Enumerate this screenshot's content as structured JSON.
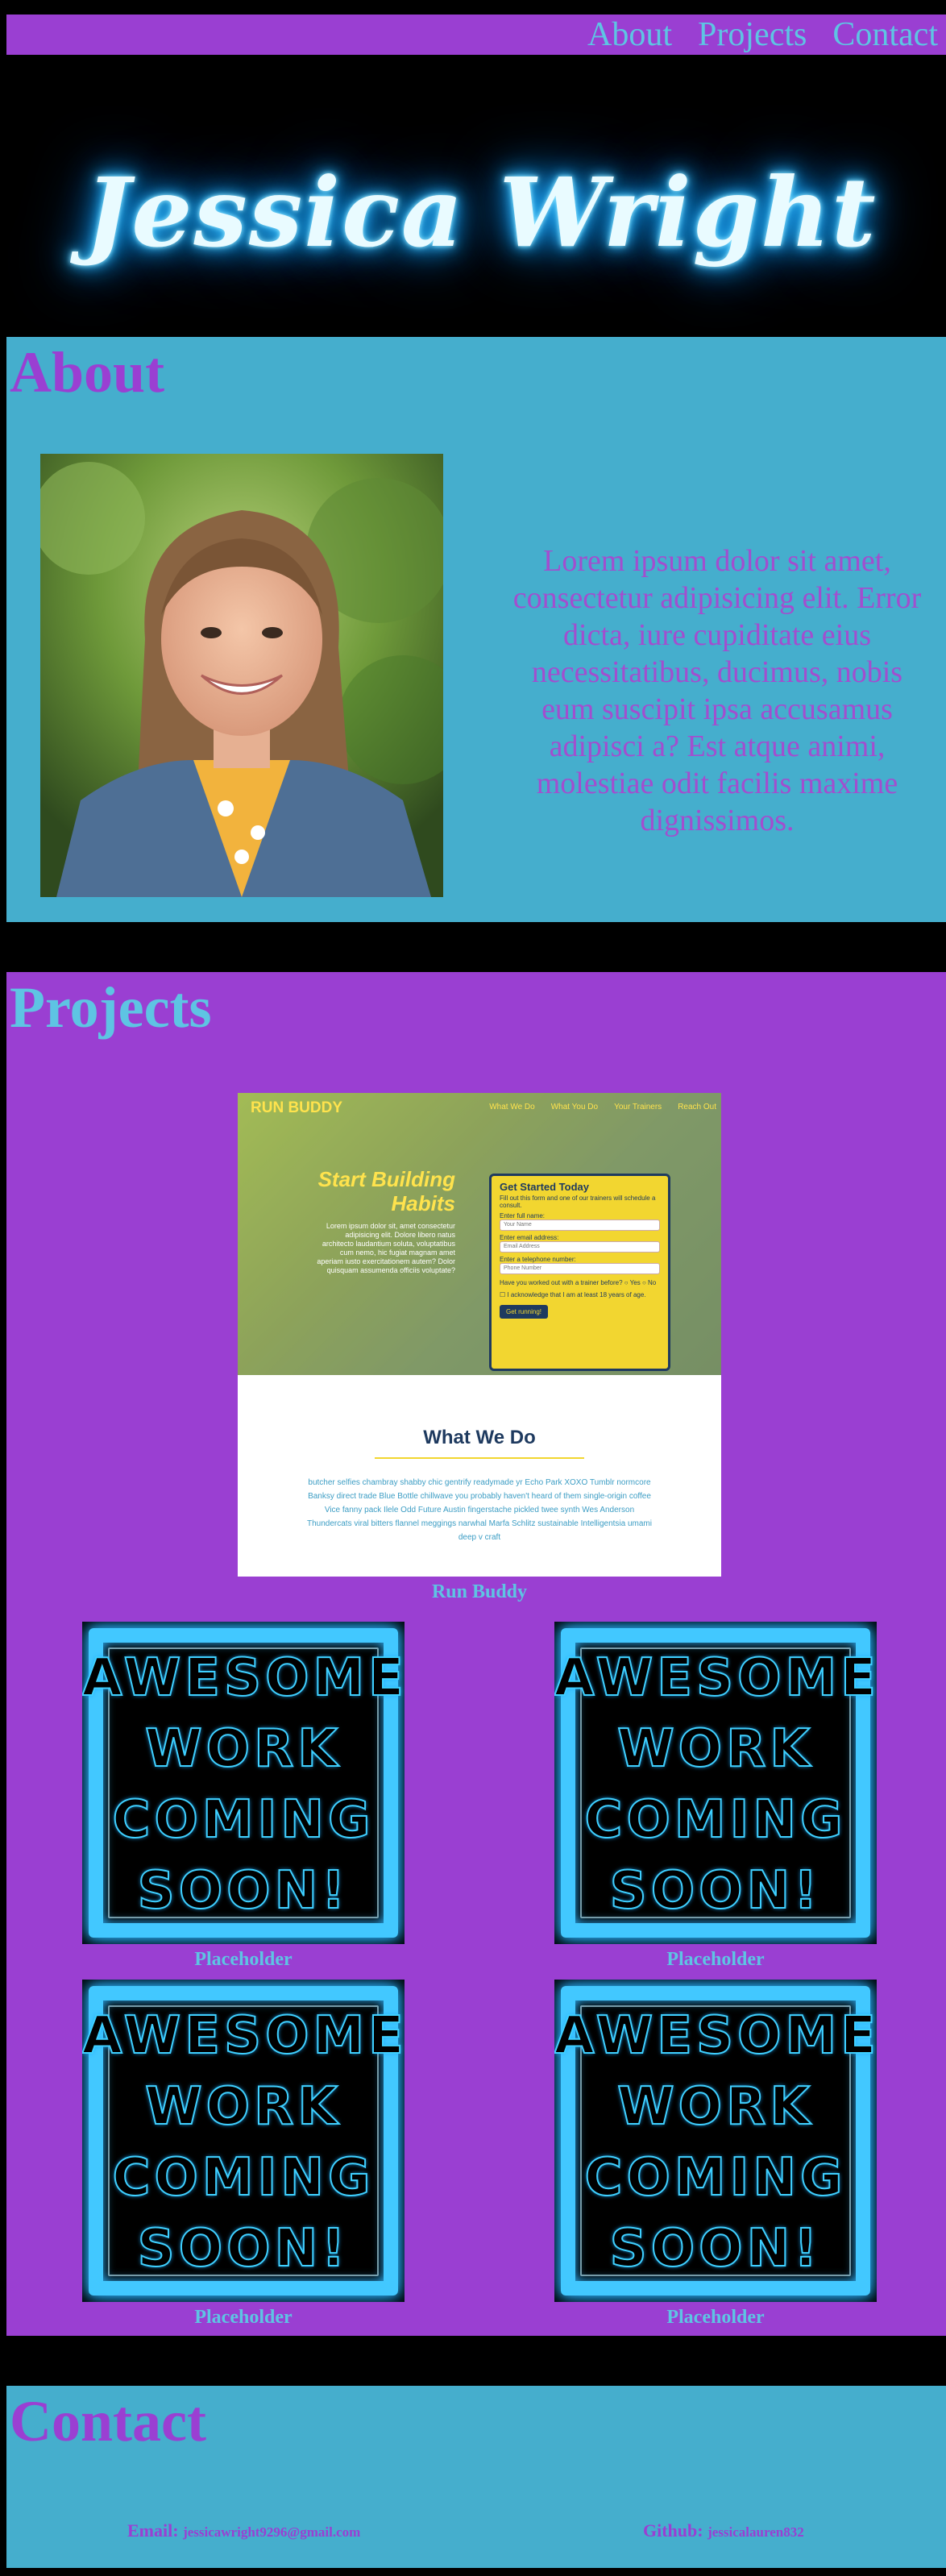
{
  "nav": {
    "links": [
      "About",
      "Projects",
      "Contact"
    ]
  },
  "hero": {
    "name": "Jessica Wright"
  },
  "about": {
    "title": "About",
    "photo_alt": "portrait-photo",
    "text": "Lorem ipsum dolor sit amet, consectetur adipisicing elit. Error dicta, iure cupiditate eius necessitatibus, ducimus, nobis eum suscipit ipsa accusamus adipisci a? Est atque animi, molestiae odit facilis maxime dignissimos."
  },
  "projects": {
    "title": "Projects",
    "featured": {
      "caption": "Run Buddy",
      "brand": "RUN BUDDY",
      "nav": [
        "What We Do",
        "What You Do",
        "Your Trainers",
        "Reach Out"
      ],
      "headline": "Start Building Habits",
      "sub": "Lorem ipsum dolor sit, amet consectetur adipisicing elit. Dolore libero natus architecto laudantium soluta, voluptatibus cum nemo, hic fugiat magnam amet aperiam iusto exercitationem autem? Dolor quisquam assumenda officiis voluptate?",
      "form": {
        "title": "Get Started Today",
        "intro": "Fill out this form and one of our trainers will schedule a consult.",
        "name_label": "Enter full name:",
        "name_placeholder": "Your Name",
        "email_label": "Enter email address:",
        "email_placeholder": "Email Address",
        "phone_label": "Enter a telephone number:",
        "phone_placeholder": "Phone Number",
        "question": "Have you worked out with a trainer before?",
        "yes": "Yes",
        "no": "No",
        "ack": "I acknowledge that I am at least 18 years of age.",
        "button": "Get running!"
      },
      "what_title": "What We Do",
      "what_body": "butcher selfies chambray shabby chic gentrify readymade yr Echo Park XOXO Tumblr normcore Banksy direct trade Blue Bottle chillwave you probably haven't heard of them single-origin coffee Vice fanny pack Ilele Odd Future Austin fingerstache pickled twee synth Wes Anderson Thundercats viral bitters flannel meggings narwhal Marfa Schlitz sustainable Intelligentsia umami deep v craft"
    },
    "placeholder_text": [
      "AWESOME",
      "WORK",
      "COMING",
      "SOON!"
    ],
    "placeholders": [
      {
        "caption": "Placeholder"
      },
      {
        "caption": "Placeholder"
      },
      {
        "caption": "Placeholder"
      },
      {
        "caption": "Placeholder"
      }
    ]
  },
  "contact": {
    "title": "Contact",
    "email_label": "Email:",
    "email": "jessicawright9296@gmail.com",
    "github_label": "Github:",
    "github": "jessicalauren832"
  },
  "colors": {
    "purple": "#9a3fd2",
    "teal": "#45aecd",
    "light_blue": "#5ec4e3",
    "neon": "#42c8ff"
  }
}
